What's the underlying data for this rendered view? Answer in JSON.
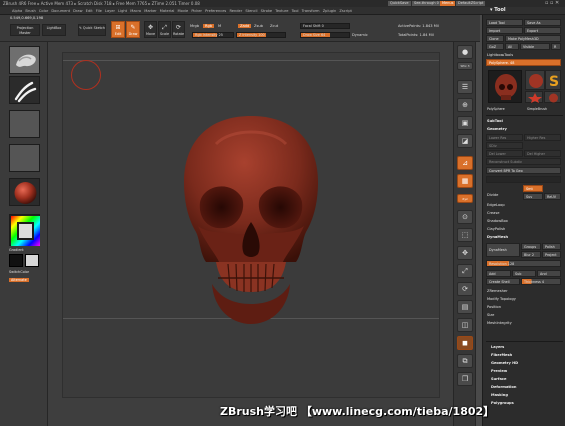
{
  "titlebar": {
    "title": "ZBrush 4R6  Free  ▸ Active Mem 473 ▸ Scratch Disk 718 ▸ Free Mem 7765 ▸ ZTime 2.051 Timer 0.08",
    "quicksave": "QuickSave",
    "seethrough": "See-through 0",
    "menus": "Menus",
    "default_zscript": "DefaultZScript"
  },
  "menubar": {
    "items": "Alpha  Brush  Color  Document  Draw  Edit  File  Layer  Light  Macro  Marker  Material  Movie  Picker  Preferences  Render  Stencil  Stroke  Texture  Tool  Transform  Zplugin  Zscript",
    "tool_tab": "Tool"
  },
  "shelf": {
    "coords": "0.549,0.669,0.198",
    "projection_master": "Projection Master",
    "lightbox": "LightBox",
    "quick_sketch": "Quick Sketch",
    "edit": "Edit",
    "draw": "Draw",
    "move": "Move",
    "scale": "Scale",
    "rotate": "Rotate",
    "mrgb": "Mrgb",
    "rgb": "Rgb",
    "m": "M",
    "zadd": "Zadd",
    "zsub": "Zsub",
    "zcut": "Zcut",
    "rgb_intensity": "Rgb Intensity 25",
    "z_intensity": "Z Intensity 100",
    "focal_shift": "Focal Shift 0",
    "draw_size": "Draw Size 64",
    "dynamic": "Dynamic",
    "active_points": "ActivePoints: 1.843 Mil",
    "total_points": "TotalPoints: 1.84 Mil"
  },
  "leftshelf": {
    "gradient_label": "Gradient",
    "switch_color_label": "SwitchColor",
    "alternate_label": "Alternate"
  },
  "righttools": {
    "bpr": "BPR",
    "spix": "SPix 3",
    "scroll": "Scroll",
    "zoom": "Zoom",
    "actual": "Actual",
    "aahalf": "AAHalf",
    "persp": "Persp",
    "floor": "Floor",
    "local": "Local",
    "xyz": "Xyz",
    "frame": "Frame",
    "move": "Move",
    "scale": "Scale",
    "rotate": "Rotate",
    "polyf": "PolyF",
    "transp": "Transp",
    "solo": "Solo",
    "xpose": "Xpose"
  },
  "palette": {
    "load_tool": "Load Tool",
    "save_as": "Save As",
    "import": "Import",
    "export": "Export",
    "clone": "Clone",
    "make_polymesh": "Make PolyMesh3D",
    "goz": "GoZ",
    "all": "All",
    "visible": "Visible",
    "r": "R",
    "lightbox_tools": "Lightbox▸Tools",
    "polysphere": "PolySphere. 48",
    "tool_names": [
      "PolySphere",
      "SimpleBrush",
      "PolyMesh3D",
      "PolySphere"
    ],
    "subtool": "SubTool",
    "geometry": "Geometry",
    "lower_res": "Lower Res",
    "higher_res": "Higher Res",
    "sdiv": "SDiv",
    "del_lower": "Del Lower",
    "del_higher": "Del Higher",
    "reconstruct_subdiv": "Reconstruct Subdiv",
    "convert_bpr": "Convert BPR To Geo",
    "divide": "Divide",
    "smt": "Smt",
    "suv": "Suv",
    "reuv": "ReUV",
    "edgeloop": "EdgeLoop",
    "crease": "Crease",
    "shadowbox": "ShadowBox",
    "claypolish": "ClayPolish",
    "dynamesh": "DynaMesh",
    "dynamesh2": "DynaMesh",
    "groups": "Groups",
    "polish": "Polish",
    "blur": "Blur 2",
    "project": "Project",
    "resolution": "Resolution 128",
    "add": "Add",
    "sub": "Sub",
    "and": "And",
    "create_shell": "Create Shell",
    "thickness": "Thickness 4",
    "zremesher": "ZRemesher",
    "modify_topology": "Modify Topology",
    "position": "Position",
    "size": "Size",
    "meshintegrity": "MeshIntegrity",
    "layers": "Layers",
    "fibermesh": "FiberMesh",
    "geometry_hd": "Geometry HD",
    "preview": "Preview",
    "surface": "Surface",
    "deformation": "Deformation",
    "masking": "Masking",
    "polygroups": "Polygroups"
  },
  "watermark": "ZBrush学习吧  【www.linecg.com/tieba/1802】",
  "colors": {
    "accent": "#d9702a",
    "skull": "#7a2a1c",
    "canvas": "#3b3b3b"
  }
}
